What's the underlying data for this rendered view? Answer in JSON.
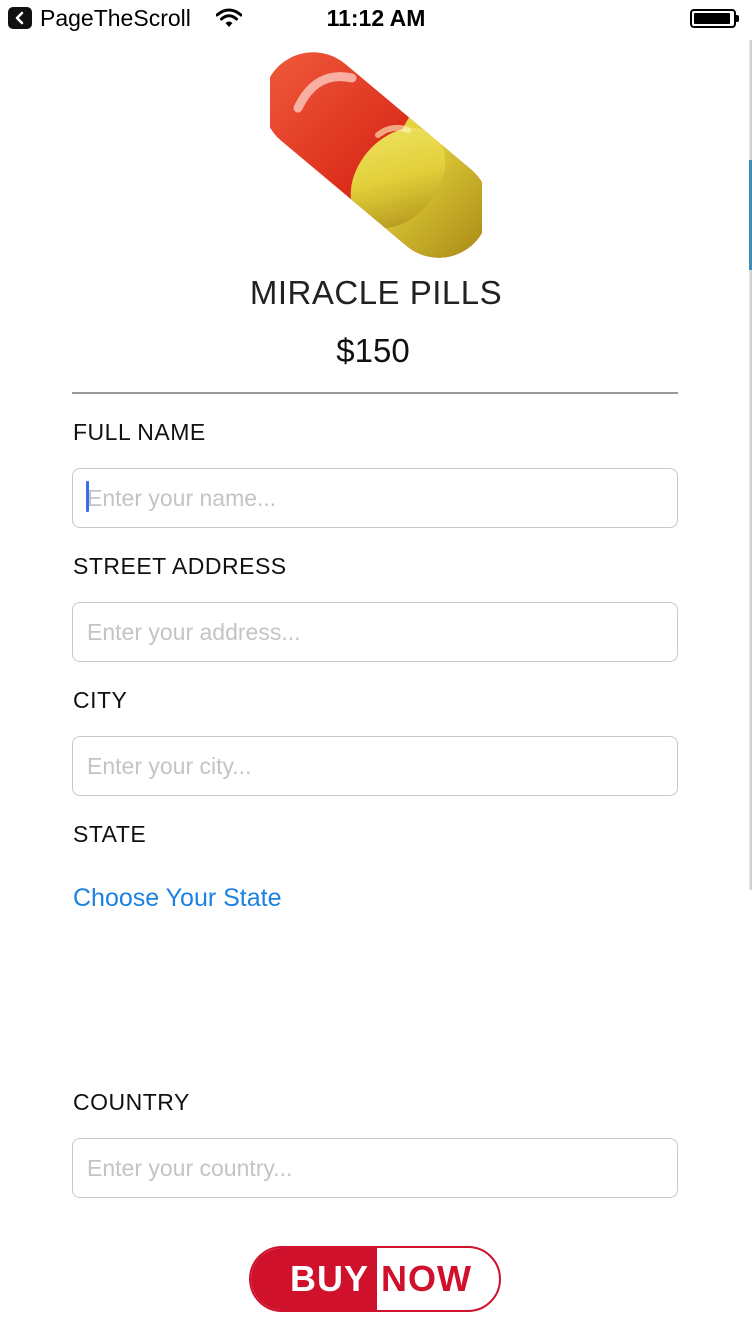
{
  "status_bar": {
    "back_app": "PageTheScroll",
    "time": "11:12 AM"
  },
  "icons": {
    "back": "chevron-left-icon",
    "wifi": "wifi-icon",
    "battery": "battery-icon",
    "product": "pill-icon"
  },
  "product": {
    "name": "MIRACLE PILLS",
    "price": "$150"
  },
  "form": {
    "full_name": {
      "label": "FULL NAME",
      "placeholder": "Enter your name...",
      "value": ""
    },
    "street": {
      "label": "STREET ADDRESS",
      "placeholder": "Enter your address...",
      "value": ""
    },
    "city": {
      "label": "CITY",
      "placeholder": "Enter your city...",
      "value": ""
    },
    "state": {
      "label": "STATE",
      "picker_label": "Choose Your State"
    },
    "country": {
      "label": "COUNTRY",
      "placeholder": "Enter your country...",
      "value": ""
    }
  },
  "buy_button": {
    "left_text": "BUY",
    "right_text": "NOW"
  },
  "colors": {
    "accent_red": "#d0112b",
    "link_blue": "#1a82e2",
    "caret_blue": "#3a6ee8"
  }
}
